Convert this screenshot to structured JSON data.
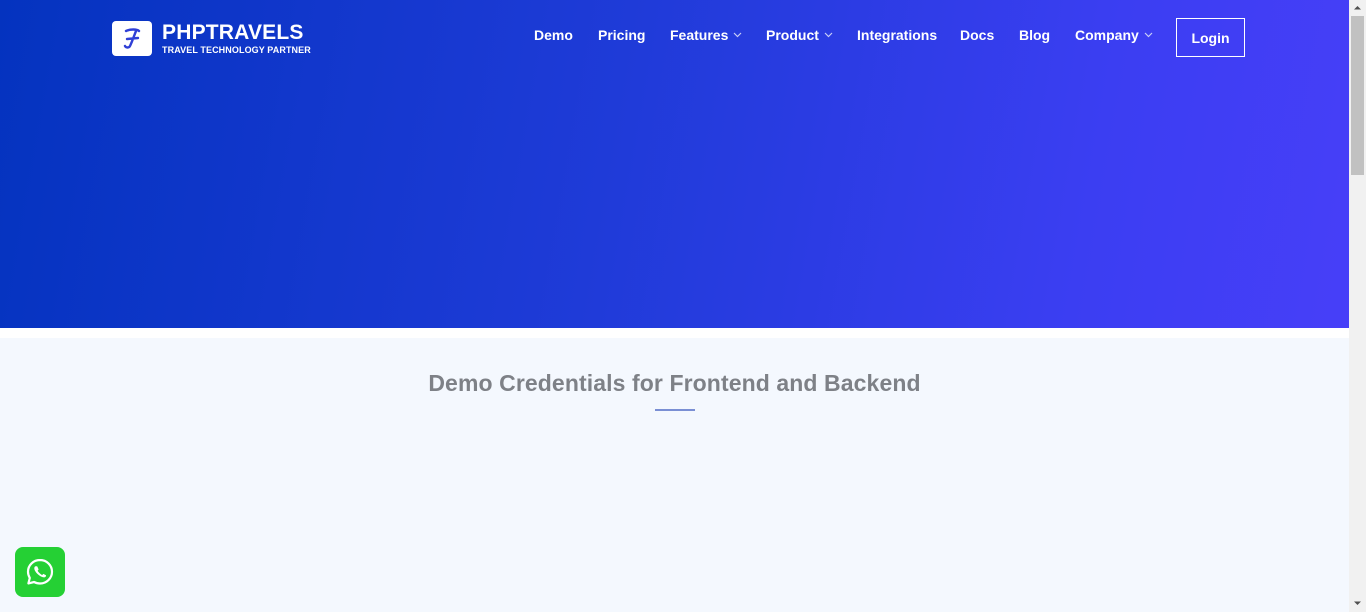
{
  "brand": {
    "name": "PHPTRAVELS",
    "tagline": "TRAVEL TECHNOLOGY PARTNER",
    "logo_letter": "J"
  },
  "nav": {
    "items": [
      {
        "label": "Demo",
        "has_dropdown": false
      },
      {
        "label": "Pricing",
        "has_dropdown": false
      },
      {
        "label": "Features",
        "has_dropdown": true
      },
      {
        "label": "Product",
        "has_dropdown": true
      },
      {
        "label": "Integrations",
        "has_dropdown": false
      },
      {
        "label": "Docs",
        "has_dropdown": false
      },
      {
        "label": "Blog",
        "has_dropdown": false
      },
      {
        "label": "Company",
        "has_dropdown": true
      }
    ],
    "login_label": "Login"
  },
  "main": {
    "section_title": "Demo Credentials for Frontend and Backend"
  },
  "floating": {
    "whatsapp_icon": "whatsapp-icon"
  },
  "colors": {
    "hero_start": "#0433bf",
    "hero_end": "#473ff8",
    "page_bg": "#f4f8fe",
    "whatsapp": "#25d034",
    "title_text": "#7e8187"
  }
}
